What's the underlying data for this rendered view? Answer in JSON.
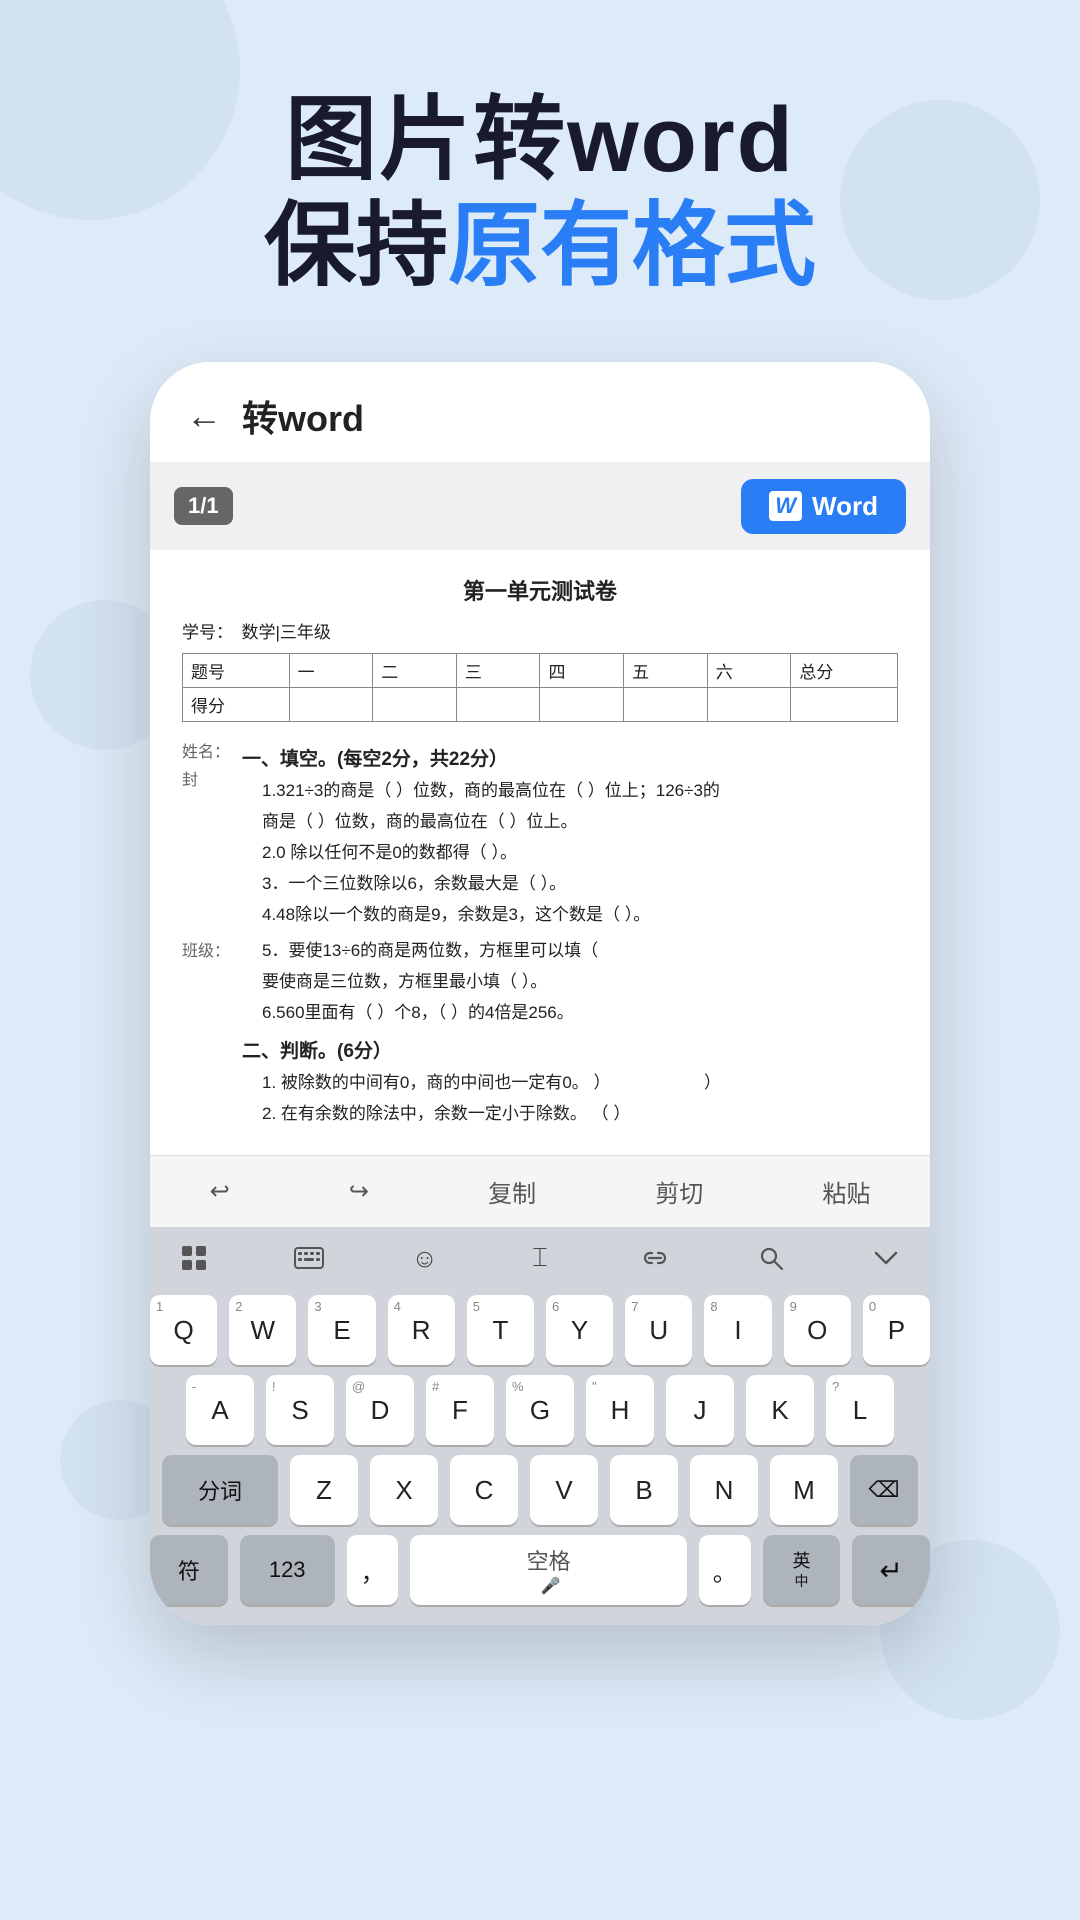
{
  "header": {
    "line1": "图片转word",
    "line2_before": "保持",
    "line2_highlight": "原有格式",
    "line2_after": ""
  },
  "phone": {
    "back_label": "←",
    "title": "转word",
    "page_badge": "1/1",
    "word_btn_label": "Word",
    "doc": {
      "title": "第一单元测试卷",
      "meta_subject": "数学|三年级",
      "meta_label": "学号：",
      "table": {
        "headers": [
          "题号",
          "一",
          "二",
          "三",
          "四",
          "五",
          "六",
          "总分"
        ],
        "row": [
          "得分",
          "",
          "",
          "",
          "",
          "",
          "",
          ""
        ]
      },
      "name_label": "姓名：",
      "seal_label": "封",
      "class_label": "班级：",
      "sections": [
        {
          "title": "一、填空。(每空2分，共22分）",
          "questions": [
            "1.321÷3的商是（ ）位数，商的最高位在（ ）位上；126÷3的商是（ ）位数，商的最高位在（ ）位上。",
            "2.0 除以任何不是0的数都得（ ）。",
            "3．一个三位数除以6，余数最大是（ ）。",
            "4.48除以一个数的商是9，余数是3，这个数是（ ）。",
            "5．要使13÷6的商是两位数，方框里可以填（要使商是三位数，方框里最小填（ ）。",
            "6.560里面有（ ）个8，（ ）的4倍是256。"
          ]
        },
        {
          "title": "二、判断。(6分）",
          "questions": [
            "1. 被除数的中间有0，商的中间也一定有0。  ）              ）",
            "2. 在有余数的除法中，余数一定小于除数。  （ ）"
          ]
        }
      ]
    },
    "edit_toolbar": {
      "undo": "↩",
      "redo": "↪",
      "copy": "复制",
      "cut": "剪切",
      "paste": "粘贴"
    },
    "keyboard": {
      "toolbar_icons": [
        "grid",
        "keyboard",
        "emoji",
        "cursor",
        "link",
        "search",
        "chevron"
      ],
      "row1": [
        {
          "label": "Q",
          "sub": "1"
        },
        {
          "label": "W",
          "sub": "2"
        },
        {
          "label": "E",
          "sub": "3"
        },
        {
          "label": "R",
          "sub": "4"
        },
        {
          "label": "T",
          "sub": "5"
        },
        {
          "label": "Y",
          "sub": "6"
        },
        {
          "label": "U",
          "sub": "7"
        },
        {
          "label": "I",
          "sub": "8"
        },
        {
          "label": "O",
          "sub": "9"
        },
        {
          "label": "P",
          "sub": "0"
        }
      ],
      "row2": [
        {
          "label": "A",
          "sub": "-"
        },
        {
          "label": "S",
          "sub": "!"
        },
        {
          "label": "D",
          "sub": "@"
        },
        {
          "label": "F",
          "sub": "#"
        },
        {
          "label": "G",
          "sub": "%"
        },
        {
          "label": "H",
          "sub": "\""
        },
        {
          "label": "J",
          "sub": ""
        },
        {
          "label": "K",
          "sub": ""
        },
        {
          "label": "L",
          "sub": "?"
        }
      ],
      "row3": [
        {
          "label": "分词",
          "wide": true,
          "gray": true
        },
        {
          "label": "Z",
          "sub": ""
        },
        {
          "label": "X",
          "sub": ""
        },
        {
          "label": "C",
          "sub": ""
        },
        {
          "label": "V",
          "sub": ""
        },
        {
          "label": "B",
          "sub": ""
        },
        {
          "label": "N",
          "sub": ""
        },
        {
          "label": "M",
          "sub": ""
        },
        {
          "label": "⌫",
          "gray": true
        }
      ],
      "row4": [
        {
          "label": "符",
          "gray": true,
          "wide": false
        },
        {
          "label": "123",
          "gray": true,
          "wide": true
        },
        {
          "label": "，",
          "sub": ""
        },
        {
          "label": "空格",
          "space": true
        },
        {
          "label": "。",
          "sub": ""
        },
        {
          "label": "英\n中",
          "gray": true,
          "lang": true
        },
        {
          "label": "↵",
          "gray": true,
          "enter": true
        }
      ]
    }
  }
}
